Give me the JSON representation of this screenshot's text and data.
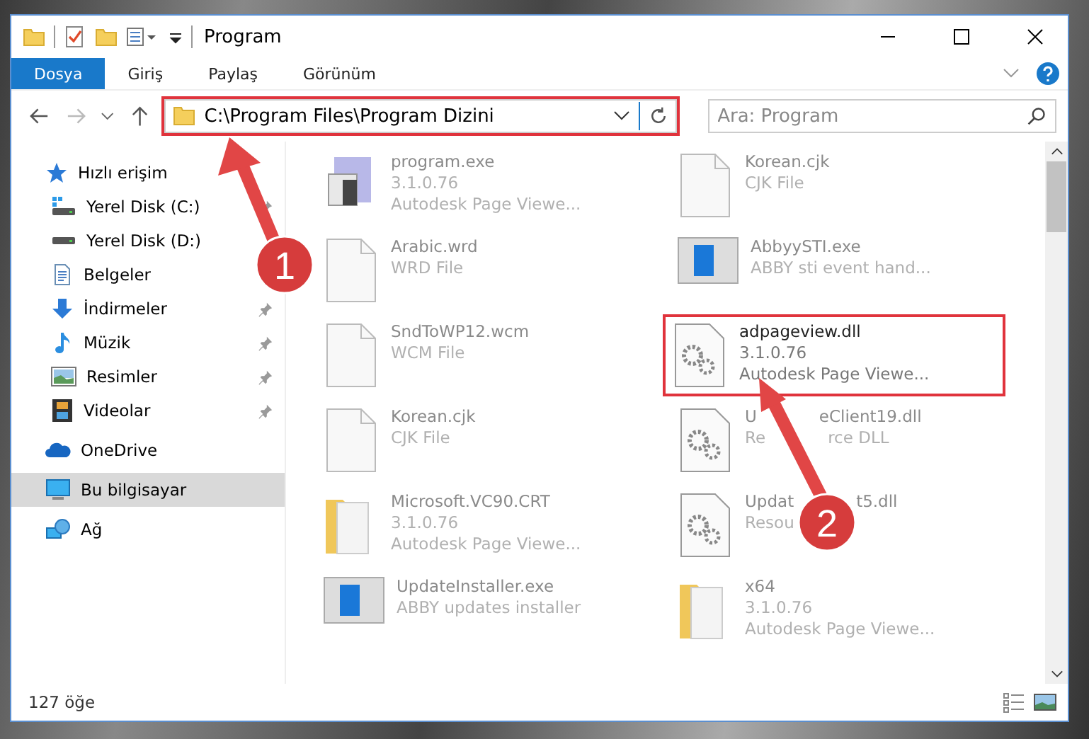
{
  "window": {
    "title": "Program"
  },
  "ribbon_tabs": [
    {
      "label": "Dosya",
      "selected": true
    },
    {
      "label": "Giriş",
      "selected": false
    },
    {
      "label": "Paylaş",
      "selected": false
    },
    {
      "label": "Görünüm",
      "selected": false
    }
  ],
  "address_bar": {
    "path": "C:\\Program Files\\Program Dizini",
    "highlighted": true
  },
  "search": {
    "placeholder": "Ara: Program"
  },
  "sidebar": {
    "items": [
      {
        "label": "Hızlı erişim",
        "kind": "star",
        "pinned": false,
        "selected": false
      },
      {
        "label": "Yerel Disk (C:)",
        "kind": "drivec",
        "pinned": true,
        "selected": false
      },
      {
        "label": "Yerel Disk (D:)",
        "kind": "drive",
        "pinned": false,
        "selected": false
      },
      {
        "label": "Belgeler",
        "kind": "docs",
        "pinned": false,
        "selected": false
      },
      {
        "label": "İndirmeler",
        "kind": "download",
        "pinned": true,
        "selected": false
      },
      {
        "label": "Müzik",
        "kind": "music",
        "pinned": true,
        "selected": false
      },
      {
        "label": "Resimler",
        "kind": "pictures",
        "pinned": true,
        "selected": false
      },
      {
        "label": "Videolar",
        "kind": "videos",
        "pinned": true,
        "selected": false
      },
      {
        "label": "OneDrive",
        "kind": "cloud",
        "pinned": false,
        "selected": false
      },
      {
        "label": "Bu bilgisayar",
        "kind": "pc",
        "pinned": false,
        "selected": true
      },
      {
        "label": "Ağ",
        "kind": "network",
        "pinned": false,
        "selected": false
      }
    ]
  },
  "files": [
    {
      "name": "program.exe",
      "lines": [
        "3.1.0.76",
        "Autodesk Page Viewe..."
      ],
      "kind": "exe",
      "highlighted": false
    },
    {
      "name": "Arabic.wrd",
      "lines": [
        "WRD File"
      ],
      "kind": "doc",
      "highlighted": false
    },
    {
      "name": "SndToWP12.wcm",
      "lines": [
        "WCM File"
      ],
      "kind": "doc",
      "highlighted": false
    },
    {
      "name": "Korean.cjk",
      "lines": [
        "CJK File"
      ],
      "kind": "doc",
      "highlighted": false
    },
    {
      "name": "Microsoft.VC90.CRT",
      "lines": [
        "3.1.0.76",
        "Autodesk Page Viewe..."
      ],
      "kind": "folder",
      "highlighted": false
    },
    {
      "name": "UpdateInstaller.exe",
      "lines": [
        "ABBY updates installer"
      ],
      "kind": "app",
      "highlighted": false
    },
    {
      "name": "Korean.cjk",
      "lines": [
        "CJK File"
      ],
      "kind": "doc",
      "highlighted": false
    },
    {
      "name": "AbbyySTI.exe",
      "lines": [
        "ABBY sti event hand..."
      ],
      "kind": "app",
      "highlighted": false
    },
    {
      "name": "adpageview.dll",
      "lines": [
        "3.1.0.76",
        "Autodesk Page Viewe..."
      ],
      "kind": "dll",
      "highlighted": true
    },
    {
      "name_parts": [
        "U",
        "eClient19.dll"
      ],
      "line_parts": [
        [
          "Re",
          "rce DLL"
        ]
      ],
      "kind": "dll",
      "highlighted": false
    },
    {
      "name_parts": [
        "Updat",
        "t5.dll"
      ],
      "line_parts": [
        [
          "Resou"
        ]
      ],
      "kind": "dll",
      "highlighted": false
    },
    {
      "name": "x64",
      "lines": [
        "3.1.0.76",
        "Autodesk Page Viewe..."
      ],
      "kind": "folder",
      "highlighted": false
    }
  ],
  "annotations": [
    {
      "number": "1"
    },
    {
      "number": "2"
    }
  ],
  "status_bar": {
    "count": "127 öğe"
  }
}
